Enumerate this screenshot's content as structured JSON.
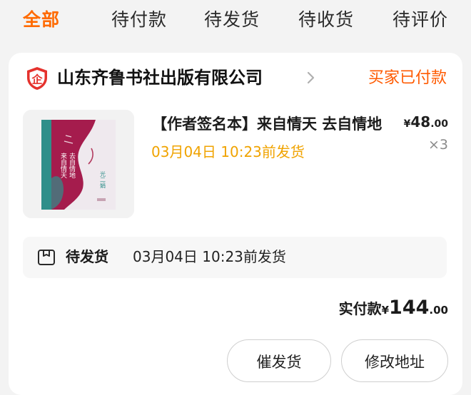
{
  "tabs": [
    {
      "label": "全部",
      "active": true
    },
    {
      "label": "待付款",
      "active": false
    },
    {
      "label": "待发货",
      "active": false
    },
    {
      "label": "待收货",
      "active": false
    },
    {
      "label": "待评价",
      "active": false
    }
  ],
  "order": {
    "shop": {
      "logo_icon": "enterprise-shield-icon",
      "logo_glyph": "企",
      "name": "山东齐鲁书社出版有限公司"
    },
    "status": "买家已付款",
    "product": {
      "title": "【作者签名本】来自情天 去自情地",
      "ship_deadline": "03月04日 10:23前发货",
      "price_symbol": "¥",
      "price_int": "48",
      "price_dec": ".00",
      "quantity": "×3",
      "cover": {
        "line1": "来自情天",
        "line2": "去自情地",
        "author": "光二娟",
        "colors": {
          "spine": "#2f8f8a",
          "wave": "#a51c4d",
          "bg": "#efe9ee"
        }
      }
    },
    "logistics": {
      "icon": "package-box-icon",
      "label": "待发货",
      "text": "03月04日 10:23前发货"
    },
    "total": {
      "label": "实付款",
      "symbol": "¥",
      "int": "144",
      "dec": ".00"
    },
    "actions": {
      "remind_label": "催发货",
      "address_label": "修改地址"
    }
  },
  "colors": {
    "accent": "#ff6a00",
    "status": "#ff5a00",
    "deadline": "#f0a300",
    "background": "#f3f3f3"
  }
}
